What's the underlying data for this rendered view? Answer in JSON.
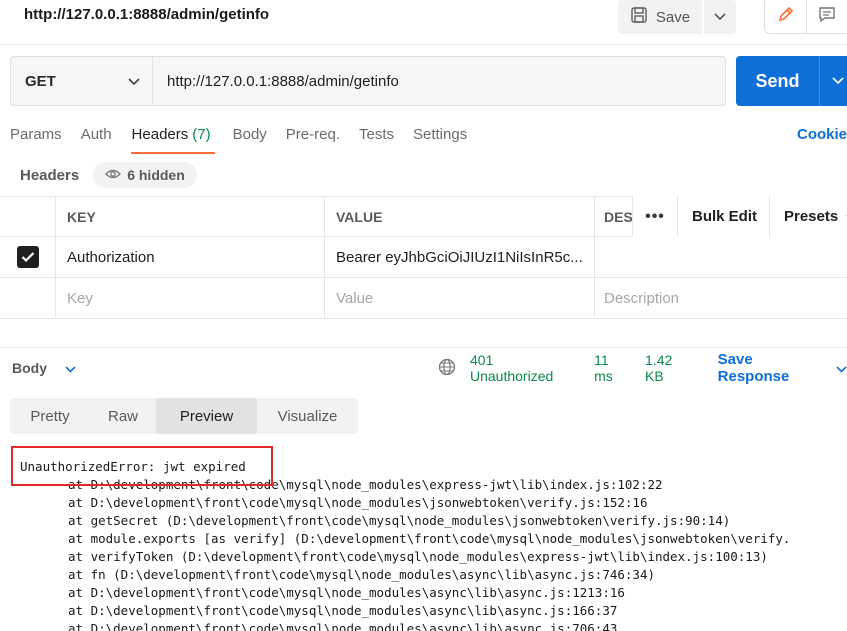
{
  "request_title": "http://127.0.0.1:8888/admin/getinfo",
  "toolbar": {
    "save_label": "Save"
  },
  "request": {
    "method": "GET",
    "url": "http://127.0.0.1:8888/admin/getinfo",
    "send_label": "Send"
  },
  "tabs": [
    {
      "label": "Params"
    },
    {
      "label": "Auth"
    },
    {
      "label": "Headers",
      "count": "(7)"
    },
    {
      "label": "Body"
    },
    {
      "label": "Pre-req."
    },
    {
      "label": "Tests"
    },
    {
      "label": "Settings"
    }
  ],
  "cookies_label": "Cookie",
  "headers_section": {
    "label": "Headers",
    "hidden_label": "6 hidden"
  },
  "table": {
    "columns": [
      "KEY",
      "VALUE",
      "DES"
    ],
    "bulk_edit": "Bulk Edit",
    "presets": "Presets",
    "rows": [
      {
        "checked": true,
        "key": "Authorization",
        "value": "Bearer eyJhbGciOiJIUzI1NiIsInR5c..."
      }
    ],
    "placeholders": {
      "key": "Key",
      "value": "Value",
      "description": "Description"
    }
  },
  "response": {
    "body_label": "Body",
    "status": "401 Unauthorized",
    "time": "11 ms",
    "size": "1.42 KB",
    "save_response": "Save Response",
    "view_tabs": [
      "Pretty",
      "Raw",
      "Preview",
      "Visualize"
    ],
    "active_view": "Preview",
    "error_line": "UnauthorizedError: jwt expired",
    "stack": [
      "at D:\\development\\front\\code\\mysql\\node_modules\\express-jwt\\lib\\index.js:102:22",
      "at D:\\development\\front\\code\\mysql\\node_modules\\jsonwebtoken\\verify.js:152:16",
      "at getSecret (D:\\development\\front\\code\\mysql\\node_modules\\jsonwebtoken\\verify.js:90:14)",
      "at module.exports [as verify] (D:\\development\\front\\code\\mysql\\node_modules\\jsonwebtoken\\verify.",
      "at verifyToken (D:\\development\\front\\code\\mysql\\node_modules\\express-jwt\\lib\\index.js:100:13)",
      "at fn (D:\\development\\front\\code\\mysql\\node_modules\\async\\lib\\async.js:746:34)",
      "at D:\\development\\front\\code\\mysql\\node_modules\\async\\lib\\async.js:1213:16",
      "at D:\\development\\front\\code\\mysql\\node_modules\\async\\lib\\async.js:166:37",
      "at D:\\development\\front\\code\\mysql\\node_modules\\async\\lib\\async.js:706:43"
    ]
  },
  "colors": {
    "accent": "#ff6c37",
    "send": "#0f6fd9",
    "status_green": "#0a8a4a",
    "highlight_red": "#e02a2a"
  }
}
